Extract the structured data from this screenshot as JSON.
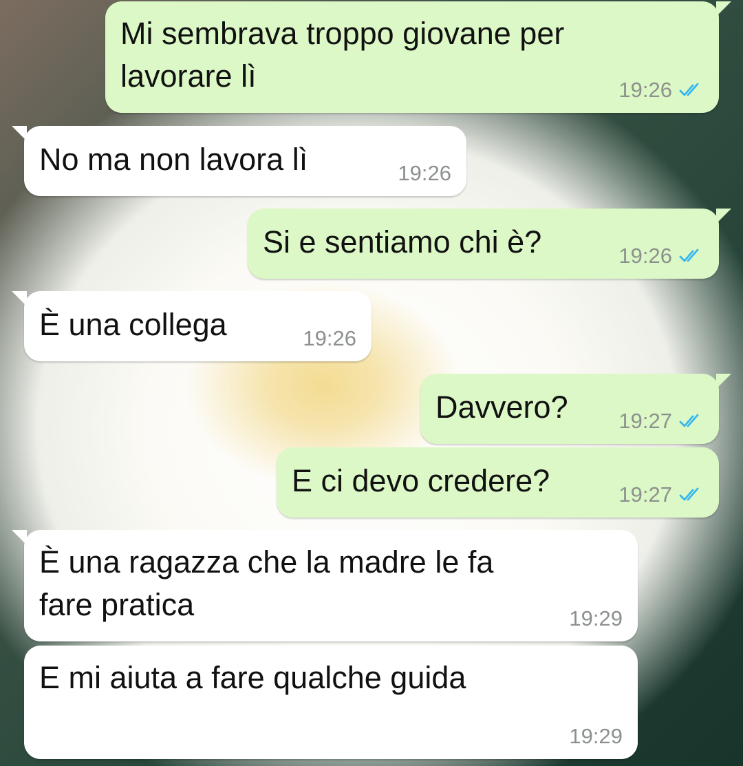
{
  "conversation": {
    "messages": [
      {
        "direction": "out",
        "text": "Mi sembrava troppo giovane per\nlavorare lì",
        "time": "19:26",
        "status": "read"
      },
      {
        "direction": "in",
        "text": "No ma non lavora lì",
        "time": "19:26"
      },
      {
        "direction": "out",
        "text": "Si e sentiamo chi è?",
        "time": "19:26",
        "status": "read"
      },
      {
        "direction": "in",
        "text": "È una collega",
        "time": "19:26"
      },
      {
        "direction": "out",
        "text": "Davvero?",
        "time": "19:27",
        "status": "read"
      },
      {
        "direction": "out",
        "text": "E ci devo credere?",
        "time": "19:27",
        "status": "read"
      },
      {
        "direction": "in",
        "text": "È una ragazza che la madre le fa\nfare pratica",
        "time": "19:29"
      },
      {
        "direction": "in",
        "text": "E mi aiuta a fare qualche guida",
        "time": "19:29"
      }
    ]
  },
  "colors": {
    "outgoing_bubble": "#dcf8c6",
    "incoming_bubble": "#ffffff",
    "read_ticks": "#34b7f1",
    "timestamp": "#8c918d"
  },
  "icons": {
    "read_receipt": "double-check-icon"
  }
}
